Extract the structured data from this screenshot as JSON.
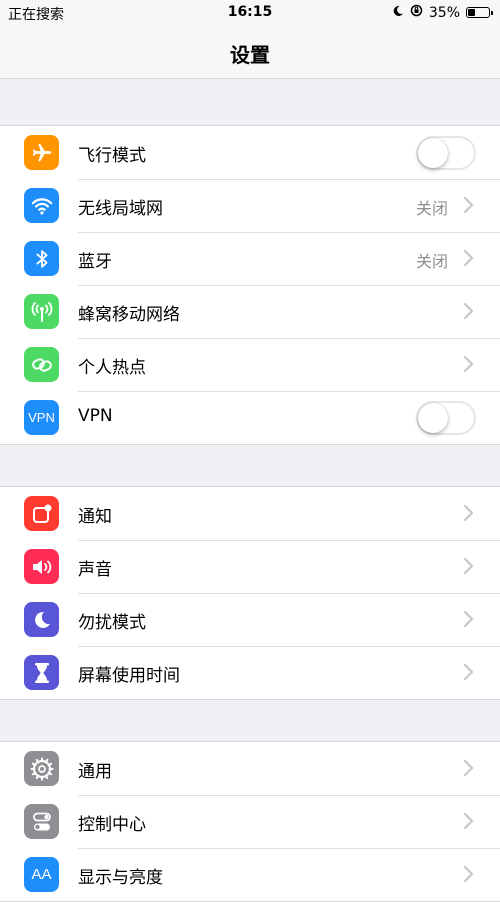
{
  "status_bar": {
    "carrier": "正在搜索",
    "time": "16:15",
    "battery_percent_text": "35%",
    "battery_level": 0.35
  },
  "nav": {
    "title": "设置"
  },
  "groups": [
    {
      "rows": [
        {
          "label": "飞行模式",
          "icon": "airplane-icon",
          "icon_color": "#ff9500",
          "accessory": "toggle",
          "toggle_on": false
        },
        {
          "label": "无线局域网",
          "icon": "wifi-icon",
          "icon_color": "#1e8efa",
          "value": "关闭",
          "accessory": "chevron"
        },
        {
          "label": "蓝牙",
          "icon": "bluetooth-icon",
          "icon_color": "#1e8efa",
          "value": "关闭",
          "accessory": "chevron"
        },
        {
          "label": "蜂窝移动网络",
          "icon": "cellular-icon",
          "icon_color": "#4cd964",
          "accessory": "chevron"
        },
        {
          "label": "个人热点",
          "icon": "hotspot-icon",
          "icon_color": "#4cd964",
          "accessory": "chevron"
        },
        {
          "label": "VPN",
          "icon": "vpn-icon",
          "icon_text": "VPN",
          "icon_color": "#1e8efa",
          "accessory": "toggle",
          "toggle_on": false
        }
      ]
    },
    {
      "rows": [
        {
          "label": "通知",
          "icon": "notifications-icon",
          "icon_color": "#ff3b30",
          "accessory": "chevron"
        },
        {
          "label": "声音",
          "icon": "sound-icon",
          "icon_color": "#ff2d55",
          "accessory": "chevron"
        },
        {
          "label": "勿扰模式",
          "icon": "moon-icon",
          "icon_color": "#5856d6",
          "accessory": "chevron"
        },
        {
          "label": "屏幕使用时间",
          "icon": "hourglass-icon",
          "icon_color": "#5856d6",
          "accessory": "chevron"
        }
      ]
    },
    {
      "rows": [
        {
          "label": "通用",
          "icon": "gear-icon",
          "icon_color": "#8e8e93",
          "accessory": "chevron"
        },
        {
          "label": "控制中心",
          "icon": "switches-icon",
          "icon_color": "#8e8e93",
          "accessory": "chevron"
        },
        {
          "label": "显示与亮度",
          "icon": "display-brightness-icon",
          "icon_text": "AA",
          "icon_color": "#1e8efa",
          "accessory": "chevron"
        }
      ]
    }
  ]
}
